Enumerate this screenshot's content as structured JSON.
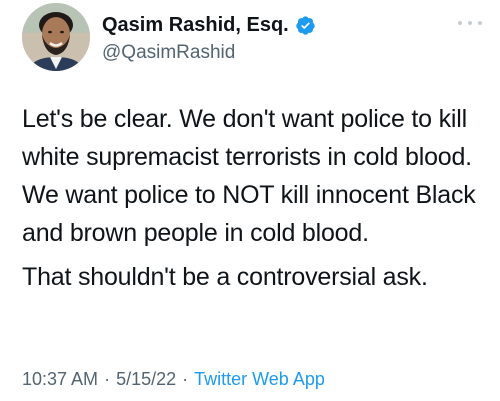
{
  "author": {
    "display_name": "Qasim Rashid, Esq.",
    "handle": "@QasimRashid",
    "verified": true
  },
  "tweet": {
    "paragraphs": [
      "Let's be clear. We don't want police to kill white supremacist terrorists in cold blood. We want police to NOT kill innocent Black and brown people in cold blood.",
      "That shouldn't be a controversial ask."
    ]
  },
  "meta": {
    "time": "10:37 AM",
    "separator": "·",
    "date": "5/15/22",
    "source": "Twitter Web App"
  },
  "icons": {
    "verified": "verified-badge-icon",
    "more": "more-options-icon"
  },
  "colors": {
    "accent": "#1d9bf0",
    "text": "#0f1419",
    "secondary": "#536471"
  }
}
